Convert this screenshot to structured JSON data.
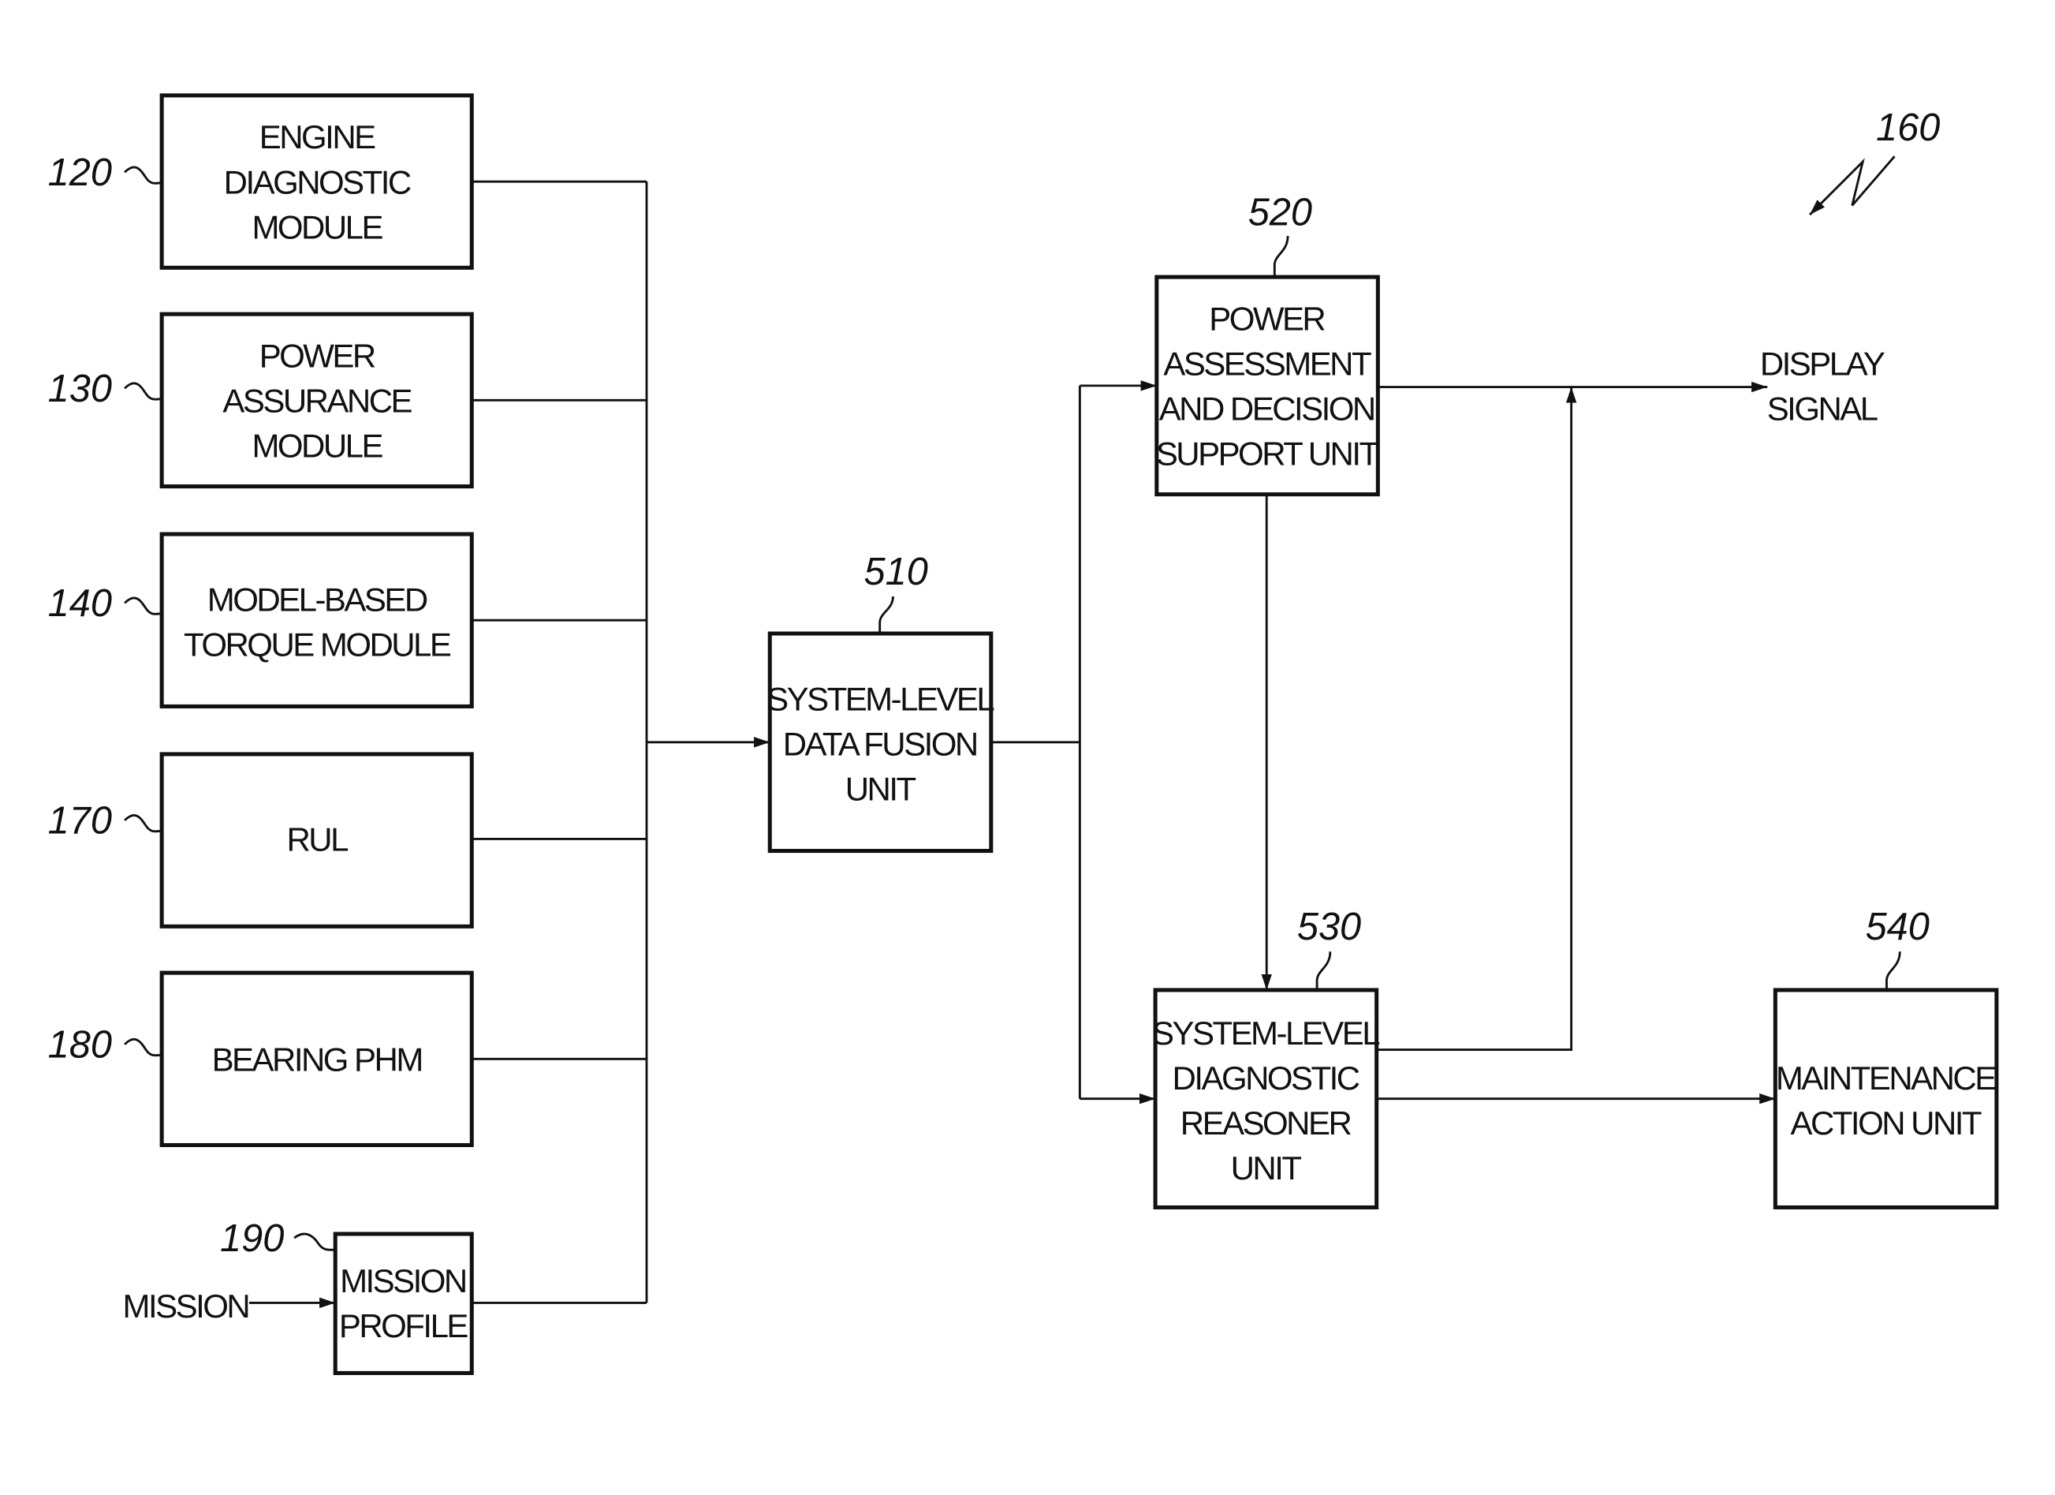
{
  "figure_ref": "160",
  "input_modules": [
    {
      "ref": "120",
      "lines": [
        "ENGINE",
        "DIAGNOSTIC",
        "MODULE"
      ]
    },
    {
      "ref": "130",
      "lines": [
        "POWER",
        "ASSURANCE",
        "MODULE"
      ]
    },
    {
      "ref": "140",
      "lines": [
        "MODEL-BASED",
        "TORQUE MODULE"
      ]
    },
    {
      "ref": "170",
      "lines": [
        "RUL"
      ]
    },
    {
      "ref": "180",
      "lines": [
        "BEARING PHM"
      ]
    },
    {
      "ref": "190",
      "lines": [
        "MISSION",
        "PROFILE"
      ]
    }
  ],
  "mission_input": "MISSION",
  "units": {
    "fusion": {
      "ref": "510",
      "lines": [
        "SYSTEM-LEVEL",
        "DATA FUSION",
        "UNIT"
      ]
    },
    "power_assessment": {
      "ref": "520",
      "lines": [
        "POWER",
        "ASSESSMENT",
        "AND DECISION",
        "SUPPORT UNIT"
      ]
    },
    "reasoner": {
      "ref": "530",
      "lines": [
        "SYSTEM-LEVEL",
        "DIAGNOSTIC",
        "REASONER",
        "UNIT"
      ]
    },
    "maintenance": {
      "ref": "540",
      "lines": [
        "MAINTENANCE",
        "ACTION UNIT"
      ]
    }
  },
  "output": {
    "lines": [
      "DISPLAY",
      "SIGNAL"
    ]
  }
}
